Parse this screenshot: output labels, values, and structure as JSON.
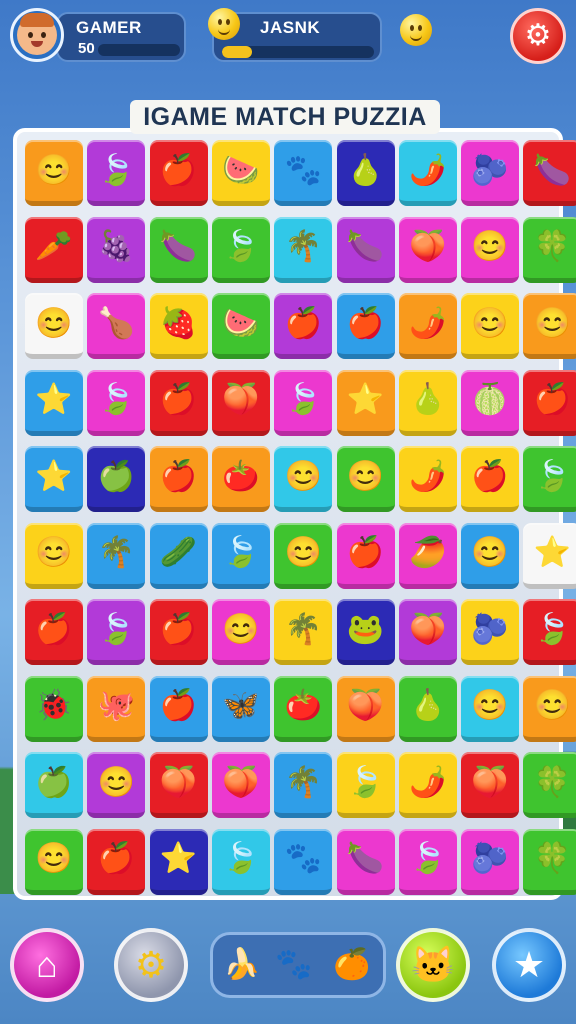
{
  "player": {
    "name": "GAMER",
    "score": "50",
    "avatar_icon": "boy-avatar-icon"
  },
  "opponent": {
    "name": "JASNK",
    "progress": 0.2,
    "icon": "smiley-coin-icon"
  },
  "title": "IGAME MATCH PUZZIA",
  "colors": {
    "orange": "#f99a1c",
    "purple": "#b23ad8",
    "red": "#e61e25",
    "yellow": "#fcd21a",
    "blue": "#2f9ee8",
    "navy": "#2c2ab5",
    "magenta": "#ec38cf",
    "green": "#3fc42f",
    "white": "#f7f7f7",
    "cyan": "#31c8e8"
  },
  "board": {
    "rows": [
      [
        [
          "orange",
          "😊"
        ],
        [
          "purple",
          "🍃"
        ],
        [
          "red",
          "🍎"
        ],
        [
          "yellow",
          "🍉"
        ],
        [
          "blue",
          "🐾"
        ],
        [
          "navy",
          "🍐"
        ],
        [
          "cyan",
          "🌶️"
        ],
        [
          "magenta",
          "🫐"
        ],
        [
          "red",
          "🍆"
        ]
      ],
      [
        [
          "red",
          "🥕"
        ],
        [
          "purple",
          "🍇"
        ],
        [
          "green",
          "🍆"
        ],
        [
          "green",
          "🍃"
        ],
        [
          "cyan",
          "🌴"
        ],
        [
          "purple",
          "🍆"
        ],
        [
          "magenta",
          "🍑"
        ],
        [
          "magenta",
          "😊"
        ],
        [
          "green",
          "🍀"
        ]
      ],
      [
        [
          "white",
          "😊"
        ],
        [
          "magenta",
          "🍗"
        ],
        [
          "yellow",
          "🍓"
        ],
        [
          "green",
          "🍉"
        ],
        [
          "purple",
          "🍎"
        ],
        [
          "blue",
          "🍎"
        ],
        [
          "orange",
          "🌶️"
        ],
        [
          "yellow",
          "😊"
        ],
        [
          "orange",
          "😊"
        ]
      ],
      [
        [
          "blue",
          "⭐"
        ],
        [
          "magenta",
          "🍃"
        ],
        [
          "red",
          "🍎"
        ],
        [
          "red",
          "🍑"
        ],
        [
          "magenta",
          "🍃"
        ],
        [
          "orange",
          "⭐"
        ],
        [
          "yellow",
          "🍐"
        ],
        [
          "magenta",
          "🍈"
        ],
        [
          "red",
          "🍎"
        ]
      ],
      [
        [
          "blue",
          "⭐"
        ],
        [
          "navy",
          "🍏"
        ],
        [
          "orange",
          "🍎"
        ],
        [
          "orange",
          "🍅"
        ],
        [
          "cyan",
          "😊"
        ],
        [
          "green",
          "😊"
        ],
        [
          "yellow",
          "🌶️"
        ],
        [
          "yellow",
          "🍎"
        ],
        [
          "green",
          "🍃"
        ]
      ],
      [
        [
          "yellow",
          "😊"
        ],
        [
          "blue",
          "🌴"
        ],
        [
          "blue",
          "🥒"
        ],
        [
          "blue",
          "🍃"
        ],
        [
          "green",
          "😊"
        ],
        [
          "magenta",
          "🍎"
        ],
        [
          "magenta",
          "🥭"
        ],
        [
          "blue",
          "😊"
        ],
        [
          "white",
          "⭐"
        ]
      ],
      [
        [
          "red",
          "🍎"
        ],
        [
          "purple",
          "🍃"
        ],
        [
          "red",
          "🍎"
        ],
        [
          "magenta",
          "😊"
        ],
        [
          "yellow",
          "🌴"
        ],
        [
          "navy",
          "🐸"
        ],
        [
          "purple",
          "🍑"
        ],
        [
          "yellow",
          "🫐"
        ],
        [
          "red",
          "🍃"
        ]
      ],
      [
        [
          "green",
          "🐞"
        ],
        [
          "orange",
          "🐙"
        ],
        [
          "blue",
          "🍎"
        ],
        [
          "blue",
          "🦋"
        ],
        [
          "green",
          "🍅"
        ],
        [
          "orange",
          "🍑"
        ],
        [
          "green",
          "🍐"
        ],
        [
          "cyan",
          "😊"
        ],
        [
          "orange",
          "😊"
        ]
      ],
      [
        [
          "cyan",
          "🍏"
        ],
        [
          "purple",
          "😊"
        ],
        [
          "red",
          "🍑"
        ],
        [
          "magenta",
          "🍑"
        ],
        [
          "blue",
          "🌴"
        ],
        [
          "yellow",
          "🍃"
        ],
        [
          "yellow",
          "🌶️"
        ],
        [
          "red",
          "🍑"
        ],
        [
          "green",
          "🍀"
        ]
      ],
      [
        [
          "green",
          "😊"
        ],
        [
          "red",
          "🍎"
        ],
        [
          "navy",
          "⭐"
        ],
        [
          "cyan",
          "🍃"
        ],
        [
          "blue",
          "🐾"
        ],
        [
          "magenta",
          "🍆"
        ],
        [
          "magenta",
          "🍃"
        ],
        [
          "magenta",
          "🫐"
        ],
        [
          "green",
          "🍀"
        ]
      ]
    ]
  },
  "bottom": {
    "home_icon": "home-icon",
    "settings_icon": "gear-icon",
    "tray": [
      "🍌",
      "🐾",
      "🍊"
    ],
    "character_icon": "cat-face-icon",
    "favorite_icon": "star-icon"
  }
}
